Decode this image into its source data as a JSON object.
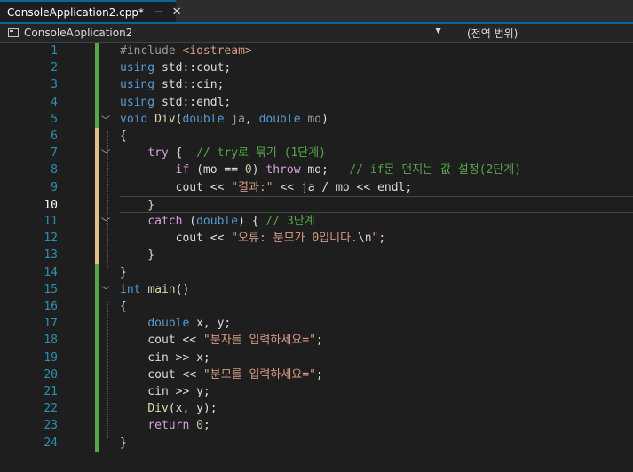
{
  "tab": {
    "title": "ConsoleApplication2.cpp*",
    "pin": "⊣",
    "close": "✕"
  },
  "nav": {
    "project": "ConsoleApplication2",
    "scope": "(전역 범위)"
  },
  "colors": {
    "accent": "#0e639c",
    "change_bar_green": "#57a64a",
    "change_bar_yellow": "#e2c08d"
  },
  "lines": [
    {
      "num": "1",
      "segs": [
        [
          "inc",
          "#include "
        ],
        [
          "incf",
          "<iostream>"
        ]
      ]
    },
    {
      "num": "2",
      "segs": [
        [
          "kw",
          "using"
        ],
        [
          "id",
          " std::cout;"
        ]
      ]
    },
    {
      "num": "3",
      "segs": [
        [
          "kw",
          "using"
        ],
        [
          "id",
          " std::cin;"
        ]
      ]
    },
    {
      "num": "4",
      "segs": [
        [
          "kw",
          "using"
        ],
        [
          "id",
          " std::endl;"
        ]
      ]
    },
    {
      "num": "5",
      "segs": [
        [
          "kw",
          "void"
        ],
        [
          "id",
          " "
        ],
        [
          "fn",
          "Div"
        ],
        [
          "id",
          "("
        ],
        [
          "kw",
          "double"
        ],
        [
          "param",
          " ja"
        ],
        [
          "id",
          ", "
        ],
        [
          "kw",
          "double"
        ],
        [
          "param",
          " mo"
        ],
        [
          "id",
          ")"
        ]
      ]
    },
    {
      "num": "6",
      "segs": [
        [
          "id",
          "{"
        ]
      ]
    },
    {
      "num": "7",
      "segs": [
        [
          "id",
          "    "
        ],
        [
          "ctl",
          "try"
        ],
        [
          "id",
          " {  "
        ],
        [
          "cmt",
          "// try로 묶기 (1단계)"
        ]
      ]
    },
    {
      "num": "8",
      "segs": [
        [
          "id",
          "        "
        ],
        [
          "ctl",
          "if"
        ],
        [
          "id",
          " (mo == "
        ],
        [
          "num-lit",
          "0"
        ],
        [
          "id",
          ") "
        ],
        [
          "ctl",
          "throw"
        ],
        [
          "id",
          " mo;   "
        ],
        [
          "cmt",
          "// if문 던지는 값 설정(2단계)"
        ]
      ]
    },
    {
      "num": "9",
      "segs": [
        [
          "id",
          "        cout << "
        ],
        [
          "str",
          "\"결과:\""
        ],
        [
          "id",
          " << ja / mo << endl;"
        ]
      ]
    },
    {
      "num": "10",
      "segs": [
        [
          "id",
          "    }"
        ]
      ]
    },
    {
      "num": "11",
      "segs": [
        [
          "id",
          "    "
        ],
        [
          "ctl",
          "catch"
        ],
        [
          "id",
          " ("
        ],
        [
          "kw",
          "double"
        ],
        [
          "id",
          ") { "
        ],
        [
          "cmt",
          "// 3단계"
        ]
      ]
    },
    {
      "num": "12",
      "segs": [
        [
          "id",
          "        cout << "
        ],
        [
          "str",
          "\"오류: 분모가 0입니다."
        ],
        [
          "esc",
          "\\n"
        ],
        [
          "str",
          "\""
        ],
        [
          "id",
          ";"
        ]
      ]
    },
    {
      "num": "13",
      "segs": [
        [
          "id",
          "    }"
        ]
      ]
    },
    {
      "num": "14",
      "segs": [
        [
          "id",
          "}"
        ]
      ]
    },
    {
      "num": "15",
      "segs": [
        [
          "kw",
          "int"
        ],
        [
          "id",
          " "
        ],
        [
          "fn",
          "main"
        ],
        [
          "id",
          "()"
        ]
      ]
    },
    {
      "num": "16",
      "segs": [
        [
          "id",
          "{"
        ]
      ]
    },
    {
      "num": "17",
      "segs": [
        [
          "id",
          "    "
        ],
        [
          "kw",
          "double"
        ],
        [
          "id",
          " x, y;"
        ]
      ]
    },
    {
      "num": "18",
      "segs": [
        [
          "id",
          "    cout << "
        ],
        [
          "str",
          "\"분자를 입력하세요=\""
        ],
        [
          "id",
          ";"
        ]
      ]
    },
    {
      "num": "19",
      "segs": [
        [
          "id",
          "    cin >> x;"
        ]
      ]
    },
    {
      "num": "20",
      "segs": [
        [
          "id",
          "    cout << "
        ],
        [
          "str",
          "\"분모를 입력하세요=\""
        ],
        [
          "id",
          ";"
        ]
      ]
    },
    {
      "num": "21",
      "segs": [
        [
          "id",
          "    cin >> y;"
        ]
      ]
    },
    {
      "num": "22",
      "segs": [
        [
          "id",
          "    "
        ],
        [
          "fn",
          "Div"
        ],
        [
          "id",
          "(x, y);"
        ]
      ]
    },
    {
      "num": "23",
      "segs": [
        [
          "id",
          "    "
        ],
        [
          "ctl",
          "return"
        ],
        [
          "id",
          " "
        ],
        [
          "num-lit",
          "0"
        ],
        [
          "id",
          ";"
        ]
      ]
    },
    {
      "num": "24",
      "segs": [
        [
          "id",
          "}"
        ]
      ]
    }
  ]
}
